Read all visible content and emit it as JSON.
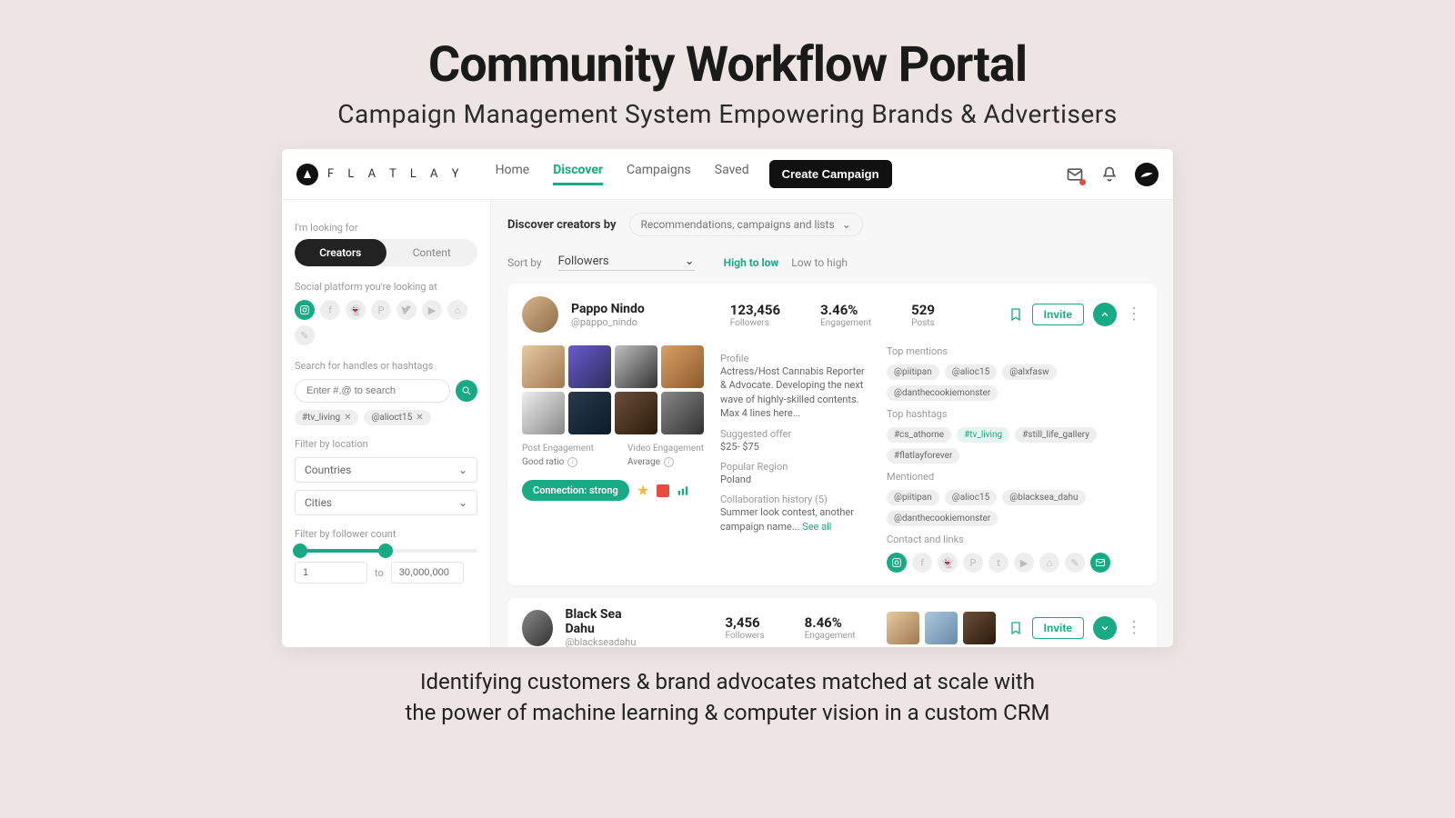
{
  "hero": {
    "title": "Community Workflow Portal",
    "subtitle": "Campaign Management System Empowering Brands & Advertisers"
  },
  "brand": {
    "name": "F L A T L A Y"
  },
  "nav": {
    "items": [
      "Home",
      "Discover",
      "Campaigns",
      "Saved"
    ],
    "active": "Discover",
    "create": "Create Campaign"
  },
  "sidebar": {
    "looking_label": "I'm looking for",
    "seg": {
      "creators": "Creators",
      "content": "Content"
    },
    "platform_label": "Social platform you're looking at",
    "search_label": "Search for handles or hashtags",
    "search_placeholder": "Enter #,@ to search",
    "search_chips": [
      "#tv_living",
      "@alioct15"
    ],
    "location_label": "Filter by location",
    "countries": "Countries",
    "cities": "Cities",
    "follower_label": "Filter by follower count",
    "range_from": "1",
    "range_to_label": "to",
    "range_to": "30,000,000"
  },
  "discover": {
    "label": "Discover creators by",
    "dropdown": "Recommendations, campaigns and lists",
    "sort_label": "Sort by",
    "sort_value": "Followers",
    "order_high": "High to low",
    "order_low": "Low to high"
  },
  "creator1": {
    "name": "Pappo Nindo",
    "handle": "@pappo_nindo",
    "followers": "123,456",
    "followers_label": "Followers",
    "engagement": "3.46%",
    "engagement_label": "Engagement",
    "posts": "529",
    "posts_label": "Posts",
    "invite": "Invite",
    "post_eng_label": "Post Engagement",
    "post_eng_value": "Good ratio",
    "video_eng_label": "Video Engagement",
    "video_eng_value": "Average",
    "connection": "Connection: strong",
    "profile_label": "Profile",
    "profile_text": "Actress/Host Cannabis Reporter & Advocate. Developing the next wave of highly-skilled contents. Max 4 lines here...",
    "offer_label": "Suggested offer",
    "offer_value": "$25- $75",
    "region_label": "Popular Region",
    "region_value": "Poland",
    "collab_label": "Collaboration history (5)",
    "collab_text": "Summer look contest, another campaign name... ",
    "see_all": "See all",
    "mentions_label": "Top mentions",
    "mentions": [
      "@piitipan",
      "@alioc15",
      "@alxfasw",
      "@danthecookiemonster"
    ],
    "hashtags_label": "Top hashtags",
    "hashtags": [
      "#cs_athome",
      "#tv_living",
      "#still_life_gallery",
      "#flatlayforever"
    ],
    "mentioned_label": "Mentioned",
    "mentioned": [
      "@piitipan",
      "@alioc15",
      "@blacksea_dahu",
      "@danthecookiemonster"
    ],
    "contact_label": "Contact and links"
  },
  "creator2": {
    "name": "Black Sea Dahu",
    "handle": "@blackseadahu",
    "followers": "3,456",
    "followers_label": "Followers",
    "engagement": "8.46%",
    "engagement_label": "Engagement",
    "invite": "Invite"
  },
  "footer": {
    "line1": "Identifying  customers & brand advocates matched at scale with",
    "line2": "the power of machine learning & computer vision in a custom CRM"
  }
}
